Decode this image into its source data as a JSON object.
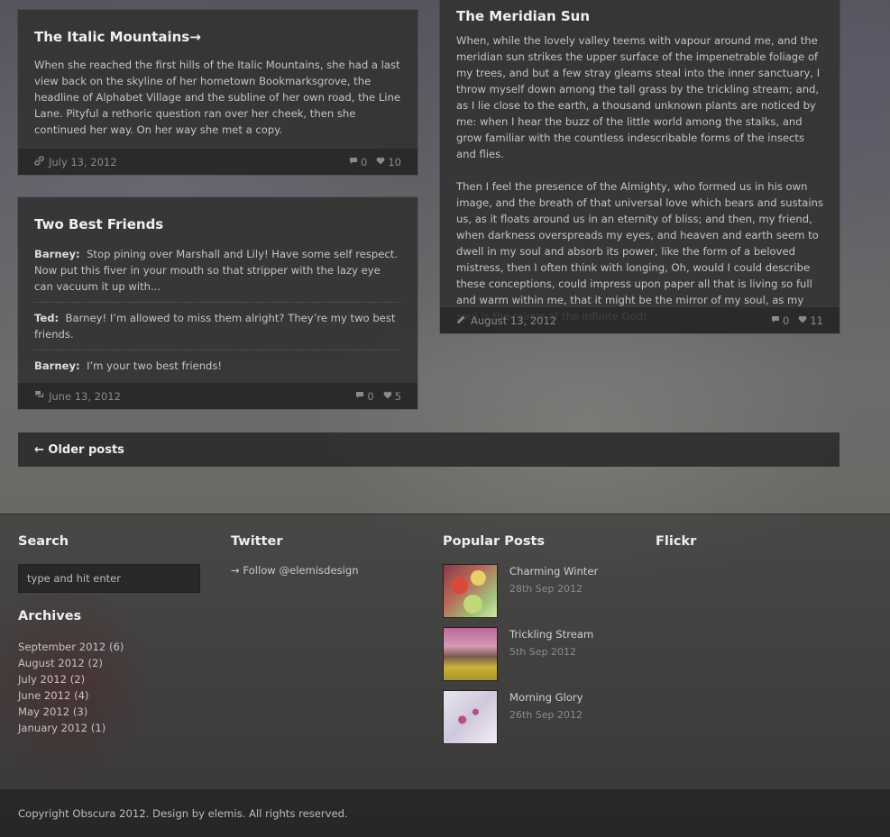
{
  "posts": {
    "italic": {
      "title": "The Italic Mountains→",
      "body": "When she reached the first hills of the Italic Mountains, she had a last view back on the skyline of her hometown Bookmarksgrove, the headline of Alphabet Village and the subline of her own road, the Line Lane. Pityful a rethoric question ran over her cheek, then she continued her way. On her way she met a copy.",
      "date": "July 13, 2012",
      "comments": "0",
      "likes": "10",
      "type_icon": "link-icon"
    },
    "friends": {
      "title": "Two Best Friends",
      "lines": [
        {
          "speaker": "Barney:",
          "text": "Stop pining over Marshall and Lily! Have some self respect. Now put this fiver in your mouth so that stripper with the lazy eye can vacuum it up with..."
        },
        {
          "speaker": "Ted:",
          "text": "Barney! I’m allowed to miss them alright? They’re my two best friends."
        },
        {
          "speaker": "Barney:",
          "text": "I’m your two best friends!"
        }
      ],
      "date": "June 13, 2012",
      "comments": "0",
      "likes": "5",
      "type_icon": "chat-icon"
    },
    "meridian": {
      "title": "The Meridian Sun",
      "paragraphs": [
        "When, while the lovely valley teems with vapour around me, and the meridian sun strikes the upper surface of the impenetrable foliage of my trees, and but a few stray gleams steal into the inner sanctuary, I throw myself down among the tall grass by the trickling stream; and, as I lie close to the earth, a thousand unknown plants are noticed by me: when I hear the buzz of the little world among the stalks, and grow familiar with the countless indescribable forms of the insects and flies.",
        "Then I feel the presence of the Almighty, who formed us in his own image, and the breath of that universal love which bears and sustains us, as it floats around us in an eternity of bliss; and then, my friend, when darkness overspreads my eyes, and heaven and earth seem to dwell in my soul and absorb its power, like the form of a beloved mistress, then I often think with longing, Oh, would I could describe these conceptions, could impress upon paper all that is living so full and warm within me, that it might be the mirror of my soul, as my soul is the mirror of the infinite God!"
      ],
      "date": "August 13, 2012",
      "comments": "0",
      "likes": "11",
      "type_icon": "pencil-icon"
    }
  },
  "pagination": {
    "older_label": "← Older posts"
  },
  "footer": {
    "search": {
      "title": "Search",
      "placeholder": "type and hit enter"
    },
    "archives": {
      "title": "Archives",
      "items": [
        "September 2012 (6)",
        "August 2012 (2)",
        "July 2012 (2)",
        "June 2012 (4)",
        "May 2012 (3)",
        "January 2012 (1)"
      ]
    },
    "twitter": {
      "title": "Twitter",
      "follow": "→ Follow @elemisdesign"
    },
    "popular": {
      "title": "Popular Posts",
      "items": [
        {
          "title": "Charming Winter",
          "date": "28th Sep 2012"
        },
        {
          "title": "Trickling Stream",
          "date": "5th Sep 2012"
        },
        {
          "title": "Morning Glory",
          "date": "26th Sep 2012"
        }
      ]
    },
    "flickr": {
      "title": "Flickr"
    },
    "copyright": "Copyright Obscura 2012. Design by elemis. All rights reserved."
  },
  "colors": {
    "panel": "#343434",
    "footer_bar": "#222222",
    "text": "#c4c4c4",
    "heading": "#f0f0f0"
  }
}
